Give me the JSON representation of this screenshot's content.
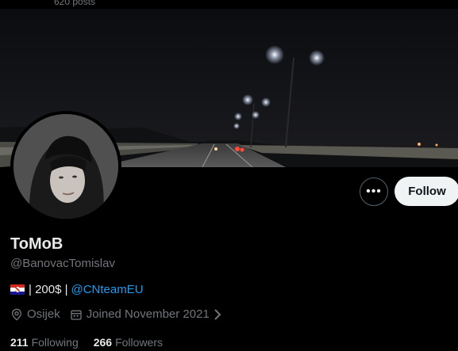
{
  "header": {
    "posts_count": "620 posts"
  },
  "profile": {
    "display_name": "ToMoB",
    "handle": "@BanovacTomislav",
    "bio": {
      "flag_icon": "croatia-flag-icon",
      "text": "| 200$ |",
      "mention": "@CNteamEU"
    },
    "location": "Osijek",
    "joined": "Joined November 2021",
    "following_count": "211",
    "following_label": "Following",
    "followers_count": "266",
    "followers_label": "Followers"
  },
  "actions": {
    "more_label": "•••",
    "follow_label": "Follow"
  },
  "colors": {
    "accent": "#1d9bf0",
    "follow_bg": "#eff3f4",
    "muted": "#71767b",
    "text": "#e7e9ea"
  }
}
